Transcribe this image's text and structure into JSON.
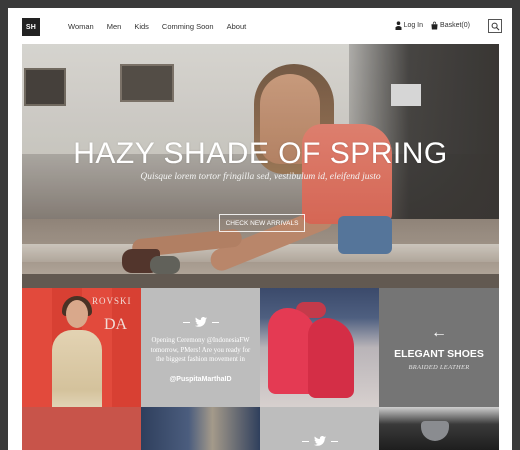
{
  "header": {
    "logo": "SH",
    "nav": [
      "Woman",
      "Men",
      "Kids",
      "Comming Soon",
      "About"
    ],
    "login_label": "Log In",
    "basket_label": "Basket(0)"
  },
  "hero": {
    "title": "HAZY SHADE OF SPRING",
    "subtitle": "Quisque lorem tortor fringilla sed, vestibulum id, eleifend justo",
    "button_label": "CHECK NEW ARRIVALS"
  },
  "tiles": {
    "photo1": {
      "brand_text_1": "ROVSKI",
      "brand_text_2": "DA"
    },
    "tweet": {
      "text": "Opening Ceremony @IndonesiaFW tomorrow, PMers! Are you ready for the biggest fashion movement in",
      "handle": "@PuspitaMarthaID"
    },
    "category": {
      "arrow": "←",
      "title": "ELEGANT SHOES",
      "subtitle": "BRAIDED LEATHER"
    }
  },
  "colors": {
    "accent_dark": "#222222",
    "tile_grey": "#bdbdbd",
    "tile_dark": "#757575",
    "tile_red": "#e6473a"
  },
  "icons": {
    "login": "person-icon",
    "basket": "bag-icon",
    "search": "search-icon",
    "twitter": "twitter-bird-icon"
  }
}
